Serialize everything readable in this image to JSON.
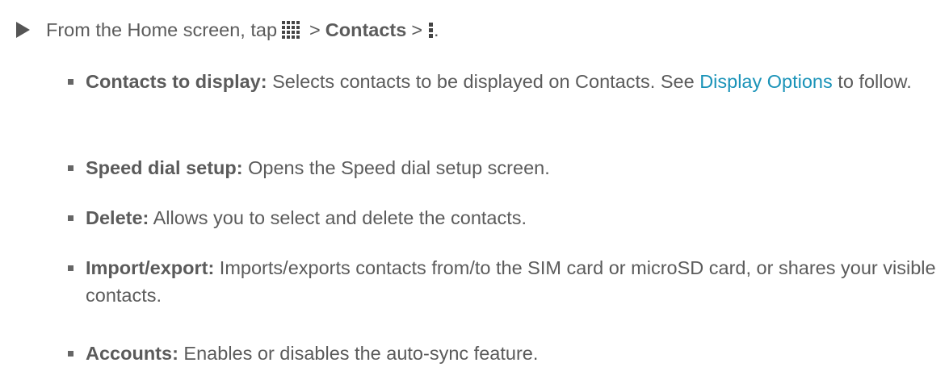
{
  "step": {
    "prefix": "From the Home screen, tap",
    "sep1": ">",
    "contacts_label": "Contacts",
    "sep2": ">",
    "end": ".",
    "apps_icon": "apps-grid-icon",
    "menu_icon": "menu-dots-icon"
  },
  "options": [
    {
      "term": "Contacts to display:",
      "desc": " Selects contacts to be displayed on Contacts. See ",
      "link": "Display Options",
      "after": " to follow."
    },
    {
      "term": "Speed dial setup:",
      "desc": " Opens the Speed dial setup screen."
    },
    {
      "term": "Delete:",
      "desc": " Allows you to select and delete the contacts."
    },
    {
      "term": "Import/export:",
      "desc": " Imports/exports contacts from/to the SIM card or microSD card, or shares your visible contacts."
    },
    {
      "term": "Accounts:",
      "desc": " Enables or disables the auto-sync feature."
    }
  ],
  "colors": {
    "text": "#5b5b5b",
    "link": "#1a93b8",
    "icon": "#444444"
  }
}
